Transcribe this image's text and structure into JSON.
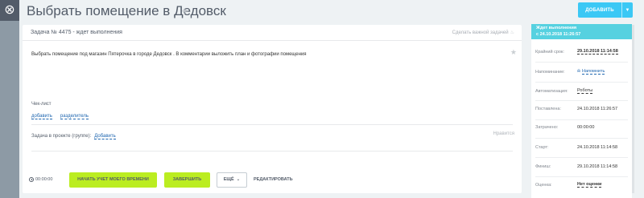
{
  "window": {
    "close_icon": "close-icon",
    "title": "Выбрать помещение в Дедовск"
  },
  "header": {
    "add_label": "ДОБАВИТЬ"
  },
  "task": {
    "header_title": "Задача № 4475 - ждет выполнения",
    "important_label": "Сделать важной задачей",
    "description": "Выбрать помещение под магазин Пятерочка в городе Дедовск . В комментарии выложить план и фотографии помещения",
    "checklist_title": "Чек-лист",
    "checklist_add": "добавить",
    "checklist_separator": "разделитель",
    "project_label": "Задача в проекте (группе):",
    "project_add": "Добавить",
    "like_label": "Нравится"
  },
  "footer": {
    "timer": "00:00:00",
    "track_time_label": "НАЧАТЬ УЧЕТ МОЕГО ВРЕМЕНИ",
    "finish_label": "ЗАВЕРШИТЬ",
    "more_label": "ЕЩЁ",
    "edit_label": "РЕДАКТИРОВАТЬ"
  },
  "sidebar": {
    "status_line1": "Ждет выполнения",
    "status_line2": "с 24.10.2018 11:26:57",
    "deadline_label": "Крайний срок:",
    "deadline_value": "29.10.2018 11:14:58",
    "reminder_label": "Напоминание:",
    "reminder_value": "Напомнить",
    "automation_label": "Автоматизация:",
    "automation_value": "Роботы",
    "created_label": "Поставлена:",
    "created_value": "24.10.2018 11:26:57",
    "spent_label": "Затрачено:",
    "spent_value": "00:00:00",
    "start_label": "Старт:",
    "start_value": "24.10.2018 11:14:58",
    "finish_label": "Финиш:",
    "finish_value": "29.10.2018 11:14:58",
    "rating_label": "Оценка:",
    "rating_value": "Нет оценки"
  },
  "colors": {
    "accent_blue": "#3bc8f5",
    "status_cyan": "#56d1e0",
    "action_green": "#bbed21",
    "link_blue": "#2067b0"
  }
}
